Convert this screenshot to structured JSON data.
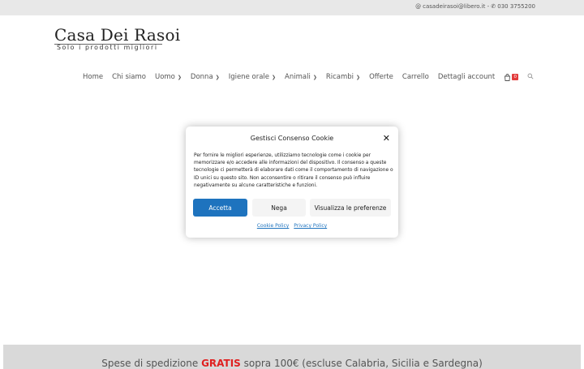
{
  "topbar": {
    "email_icon": "at-icon",
    "email": "casadeirasoi@libero.it",
    "separator": " - ",
    "phone_icon": "phone-icon",
    "phone": "030 3755200"
  },
  "logo": {
    "title": "Casa Dei Rasoi",
    "tagline": "Solo i prodotti migliori"
  },
  "nav": {
    "items": [
      {
        "label": "Home",
        "dropdown": false
      },
      {
        "label": "Chi siamo",
        "dropdown": false
      },
      {
        "label": "Uomo",
        "dropdown": true
      },
      {
        "label": "Donna",
        "dropdown": true
      },
      {
        "label": "Igiene orale",
        "dropdown": true
      },
      {
        "label": "Animali",
        "dropdown": true
      },
      {
        "label": "Ricambi",
        "dropdown": true
      },
      {
        "label": "Offerte",
        "dropdown": false
      },
      {
        "label": "Carrello",
        "dropdown": false
      },
      {
        "label": "Dettagli account",
        "dropdown": false
      }
    ],
    "cart_icon": "shopping-bag-icon",
    "cart_count": "0",
    "search_icon": "search-icon"
  },
  "cookie_modal": {
    "title": "Gestisci Consenso Cookie",
    "close_icon": "close-icon",
    "body": "Per fornire le migliori esperienze, utilizziamo tecnologie come i cookie per memorizzare e/o accedere alle informazioni del dispositivo. Il consenso a queste tecnologie ci permetterà di elaborare dati come il comportamento di navigazione o ID unici su questo sito. Non acconsentire o ritirare il consenso può influire negativamente su alcune caratteristiche e funzioni.",
    "accept_label": "Accetta",
    "deny_label": "Nega",
    "preferences_label": "Visualizza le preferenze",
    "cookie_policy_label": "Cookie Policy",
    "privacy_policy_label": "Privacy Policy"
  },
  "banner": {
    "text_before": "Spese di spedizione ",
    "highlight": "GRATIS",
    "text_after": " sopra 100€ (escluse Calabria, Sicilia e Sardegna)"
  },
  "colors": {
    "accent": "#1e73be",
    "cart_badge": "#e23b3b",
    "highlight": "#e02020",
    "topbar_bg": "#e8e8e8"
  }
}
